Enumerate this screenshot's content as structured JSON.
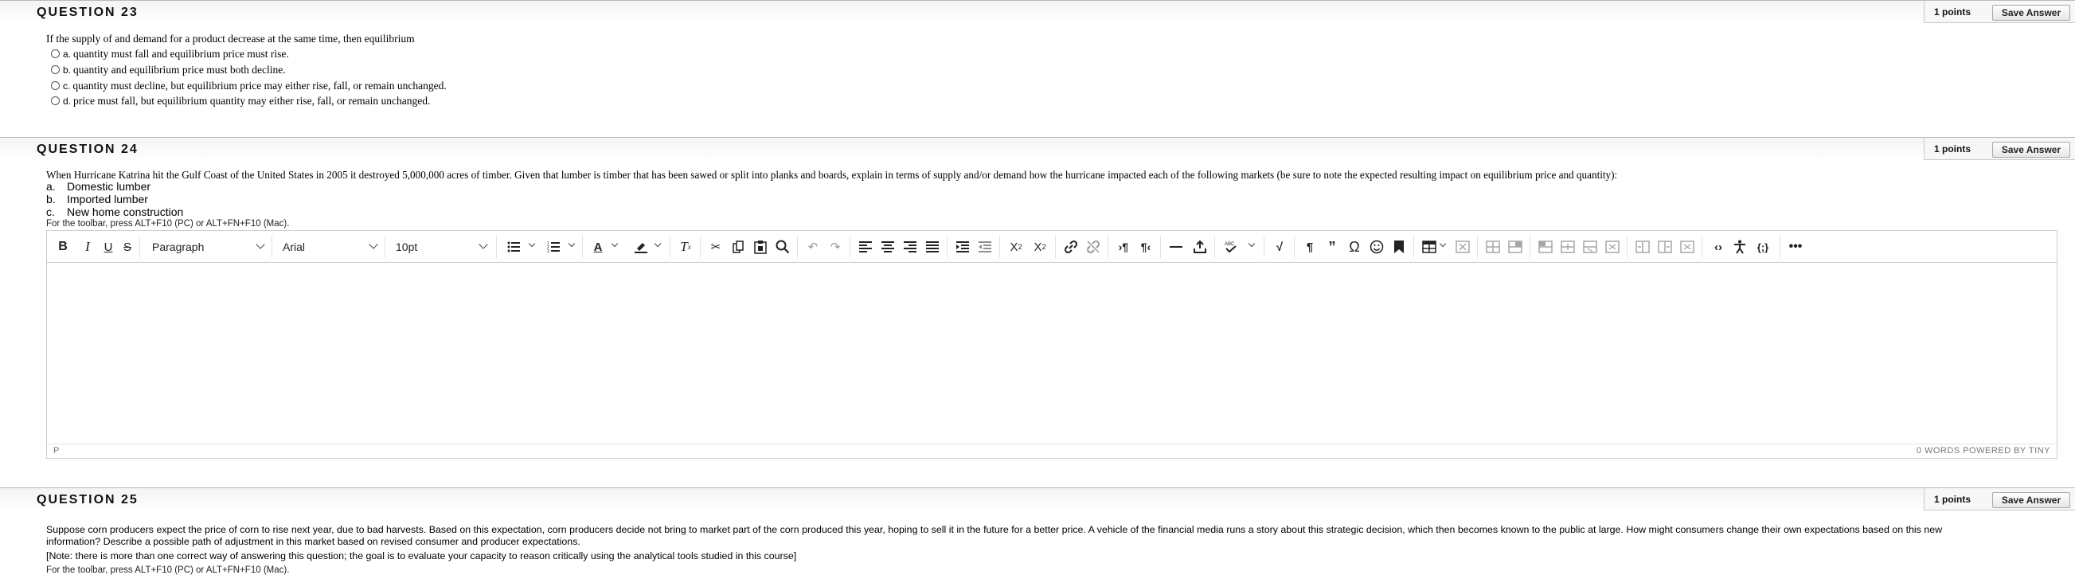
{
  "q23": {
    "title": "QUESTION 23",
    "points": "1 points",
    "save": "Save Answer",
    "text": "If the supply of and demand for a product decrease at the same time, then equilibrium",
    "options": [
      {
        "letter": "a.",
        "text": "quantity must fall and equilibrium price must rise."
      },
      {
        "letter": "b.",
        "text": "quantity and equilibrium price must both decline."
      },
      {
        "letter": "c.",
        "text": "quantity must decline, but equilibrium price may either rise, fall, or remain unchanged."
      },
      {
        "letter": "d.",
        "text": "price must fall, but equilibrium quantity may either rise, fall, or remain unchanged."
      }
    ]
  },
  "q24": {
    "title": "QUESTION 24",
    "points": "1 points",
    "save": "Save Answer",
    "text": "When Hurricane Katrina hit the Gulf Coast of the United States in 2005 it destroyed 5,000,000 acres of timber.  Given that lumber is timber that has been sawed or split into planks and boards, explain in terms of supply and/or demand how the hurricane impacted each of the following markets (be sure to note the expected resulting impact on equilibrium price and quantity):",
    "items": [
      {
        "letter": "a.",
        "text": "Domestic lumber"
      },
      {
        "letter": "b.",
        "text": "Imported lumber"
      },
      {
        "letter": "c.",
        "text": "New home construction"
      }
    ],
    "toolbar_hint": "For the toolbar, press ALT+F10 (PC) or ALT+FN+F10 (Mac).",
    "editor": {
      "block_format": "Paragraph",
      "font_family": "Arial",
      "font_size": "10pt",
      "status_path": "P",
      "status_right": "0 WORDS  POWERED BY TINY"
    }
  },
  "q25": {
    "title": "QUESTION 25",
    "points": "1 points",
    "save": "Save Answer",
    "text_line1": "Suppose corn producers expect the price of corn to rise next year, due to bad harvests. Based on this expectation, corn producers decide not bring to market part of the corn produced this year, hoping to sell it in the future for a better price. A vehicle of the financial media runs a story about this strategic decision, which then becomes known to the public at large. How might consumers change their own expectations based on this new",
    "text_line2": "information? Describe a possible path of adjustment in this market based on revised consumer and producer expectations.",
    "note": "[Note: there is more than one correct way of answering this question; the goal is to evaluate your capacity to reason critically using the analytical tools studied in this course]",
    "toolbar_hint": "For the toolbar, press ALT+F10 (PC) or ALT+FN+F10 (Mac)."
  },
  "colors": {
    "border": "#cccccc",
    "bar_bg": "#f4f4f4",
    "status_text": "#777777"
  }
}
